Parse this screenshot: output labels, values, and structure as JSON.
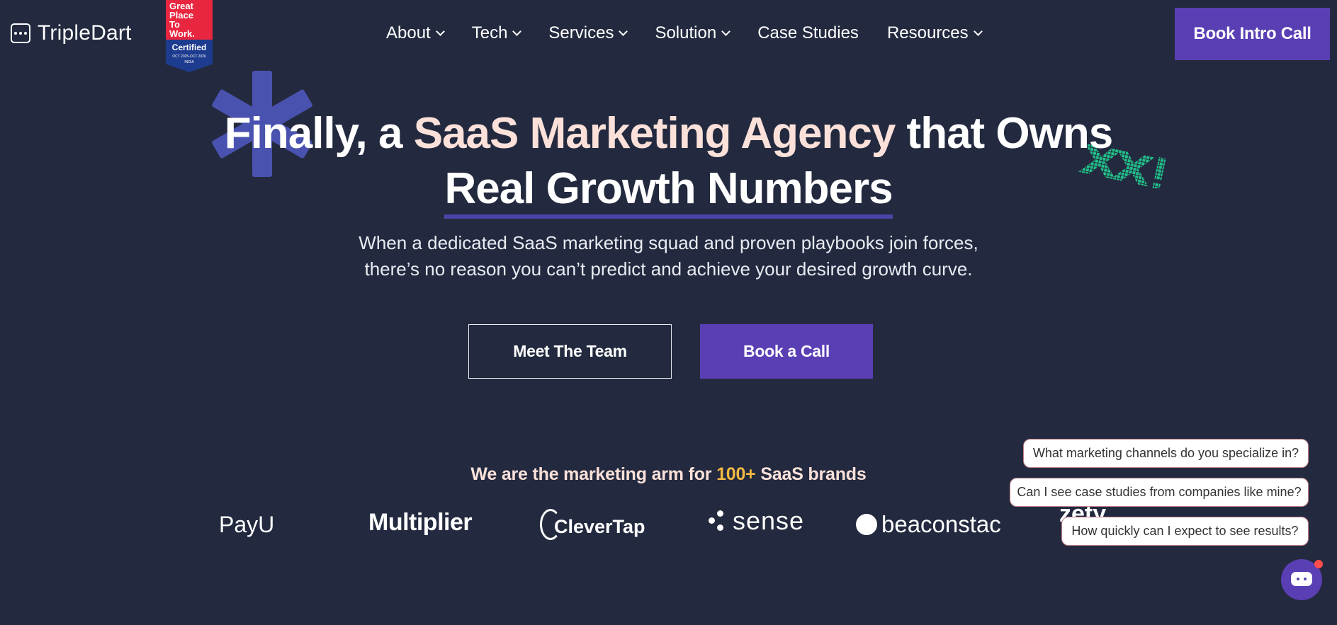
{
  "header": {
    "logo_text": "TripleDart",
    "badge": {
      "line1": "Great",
      "line2": "Place",
      "line3": "To",
      "line4": "Work.",
      "certified": "Certified",
      "dates": "OCT 2025-OCT 2026",
      "country": "INDIA"
    },
    "nav": [
      {
        "label": "About",
        "dropdown": true
      },
      {
        "label": "Tech",
        "dropdown": true
      },
      {
        "label": "Services",
        "dropdown": true
      },
      {
        "label": "Solution",
        "dropdown": true
      },
      {
        "label": "Case Studies",
        "dropdown": false
      },
      {
        "label": "Resources",
        "dropdown": true
      }
    ],
    "cta_label": "Book Intro Call"
  },
  "hero": {
    "title_part1": "Finally, a ",
    "title_accent": "SaaS Marketing Agency",
    "title_part2": " that Owns",
    "title_line2": "Real Growth Numbers",
    "subtitle_line1": "When a dedicated SaaS marketing squad and proven playbooks join forces,",
    "subtitle_line2": "there’s no reason you can’t predict and achieve your desired growth curve.",
    "btn_team": "Meet The Team",
    "btn_call": "Book a Call"
  },
  "brands": {
    "title_part1": "We are the marketing arm for ",
    "title_highlight": "100+",
    "title_part2": " SaaS brands",
    "logos": [
      "PayU",
      "Multiplier",
      "CleverTap",
      "sense",
      "beaconstac",
      "zety"
    ]
  },
  "chat": {
    "suggestions": [
      "What marketing channels do you specialize in?",
      "Can I see case studies from companies like mine?",
      "How quickly can I expect to see results?"
    ]
  },
  "colors": {
    "background": "#232a3f",
    "brand_purple": "#5a3fb4",
    "accent_peach": "#fbe1d9",
    "highlight_yellow": "#f4b942",
    "decor_green": "#22c08a",
    "decor_blue": "#4a52b0"
  }
}
